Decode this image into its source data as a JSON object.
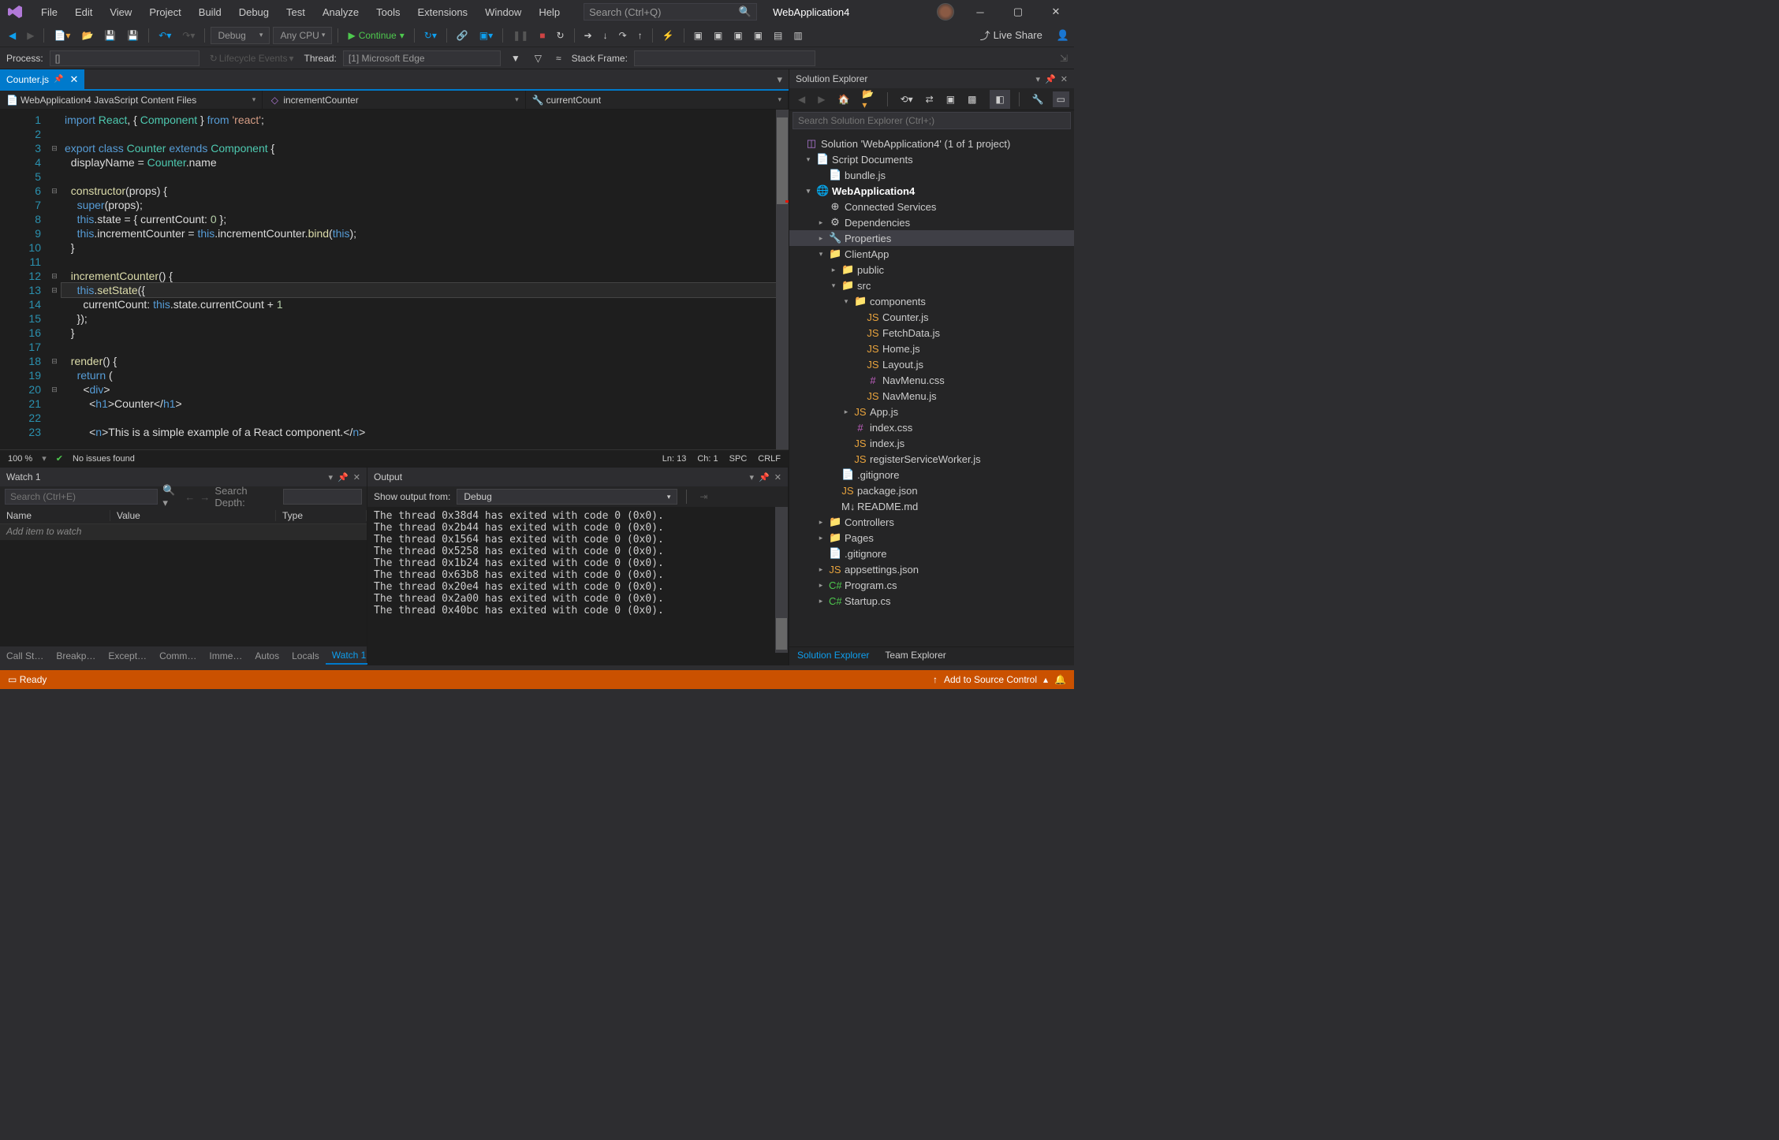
{
  "title": {
    "app": "WebApplication4",
    "search_placeholder": "Search (Ctrl+Q)"
  },
  "menu": [
    "File",
    "Edit",
    "View",
    "Project",
    "Build",
    "Debug",
    "Test",
    "Analyze",
    "Tools",
    "Extensions",
    "Window",
    "Help"
  ],
  "toolbar": {
    "config": "Debug",
    "platform": "Any CPU",
    "continue": "Continue",
    "live_share": "Live Share"
  },
  "toolbar2": {
    "process_label": "Process:",
    "process_value": "[]",
    "lifecycle": "Lifecycle Events",
    "thread_label": "Thread:",
    "thread_value": "[1] Microsoft Edge",
    "stack_label": "Stack Frame:"
  },
  "tab": {
    "name": "Counter.js"
  },
  "navbar": {
    "scope": "WebApplication4 JavaScript Content Files",
    "member": "incrementCounter",
    "detail": "currentCount"
  },
  "code": {
    "lines": [
      {
        "n": 1,
        "html": "<span class='kw'>import</span> <span class='cls'>React</span>, { <span class='cls'>Component</span> } <span class='kw'>from</span> <span class='str'>'react'</span>;"
      },
      {
        "n": 2,
        "html": ""
      },
      {
        "n": 3,
        "html": "<span class='kw'>export</span> <span class='kw'>class</span> <span class='cls'>Counter</span> <span class='kw'>extends</span> <span class='cls'>Component</span> {",
        "fold": "−"
      },
      {
        "n": 4,
        "html": "  displayName = <span class='cls'>Counter</span>.name"
      },
      {
        "n": 5,
        "html": ""
      },
      {
        "n": 6,
        "html": "  <span class='fn'>constructor</span>(props) {",
        "fold": "−"
      },
      {
        "n": 7,
        "html": "    <span class='kw'>super</span>(props);"
      },
      {
        "n": 8,
        "html": "    <span class='kw'>this</span>.state = { currentCount: <span class='num'>0</span> };"
      },
      {
        "n": 9,
        "html": "    <span class='kw'>this</span>.incrementCounter = <span class='kw'>this</span>.incrementCounter.<span class='fn'>bind</span>(<span class='kw'>this</span>);"
      },
      {
        "n": 10,
        "html": "  }"
      },
      {
        "n": 11,
        "html": ""
      },
      {
        "n": 12,
        "html": "  <span class='fn'>incrementCounter</span>() {",
        "fold": "−"
      },
      {
        "n": 13,
        "html": "    <span class='kw'>this</span>.<span class='fn'>setState</span>({",
        "current": true,
        "bp": true,
        "fold": "−"
      },
      {
        "n": 14,
        "html": "      currentCount: <span class='kw'>this</span>.state.currentCount + <span class='num'>1</span>"
      },
      {
        "n": 15,
        "html": "    });"
      },
      {
        "n": 16,
        "html": "  }"
      },
      {
        "n": 17,
        "html": ""
      },
      {
        "n": 18,
        "html": "  <span class='fn'>render</span>() {",
        "fold": "−"
      },
      {
        "n": 19,
        "html": "    <span class='kw'>return</span> ("
      },
      {
        "n": 20,
        "html": "      &lt;<span class='tag'>div</span>&gt;",
        "fold": "−"
      },
      {
        "n": 21,
        "html": "        &lt;<span class='tag'>h1</span>&gt;Counter&lt;/<span class='tag'>h1</span>&gt;"
      },
      {
        "n": 22,
        "html": ""
      },
      {
        "n": 23,
        "html": "        &lt;<span class='tag'>n</span>&gt;This is a simple example of a React component.&lt;/<span class='tag'>n</span>&gt;"
      }
    ]
  },
  "editor_status": {
    "zoom": "100 %",
    "issues": "No issues found",
    "ln": "Ln: 13",
    "ch": "Ch: 1",
    "spc": "SPC",
    "crlf": "CRLF"
  },
  "watch": {
    "title": "Watch 1",
    "search_placeholder": "Search (Ctrl+E)",
    "depth_label": "Search Depth:",
    "cols": {
      "name": "Name",
      "value": "Value",
      "type": "Type"
    },
    "add_prompt": "Add item to watch",
    "tabs": [
      "Call St…",
      "Breakp…",
      "Except…",
      "Comm…",
      "Imme…",
      "Autos",
      "Locals",
      "Watch 1"
    ]
  },
  "output": {
    "title": "Output",
    "from_label": "Show output from:",
    "from_value": "Debug",
    "lines": [
      "The thread 0x38d4 has exited with code 0 (0x0).",
      "The thread 0x2b44 has exited with code 0 (0x0).",
      "The thread 0x1564 has exited with code 0 (0x0).",
      "The thread 0x5258 has exited with code 0 (0x0).",
      "The thread 0x1b24 has exited with code 0 (0x0).",
      "The thread 0x63b8 has exited with code 0 (0x0).",
      "The thread 0x20e4 has exited with code 0 (0x0).",
      "The thread 0x2a00 has exited with code 0 (0x0).",
      "The thread 0x40bc has exited with code 0 (0x0)."
    ]
  },
  "solution": {
    "title": "Solution Explorer",
    "search_placeholder": "Search Solution Explorer (Ctrl+;)",
    "root": "Solution 'WebApplication4' (1 of 1 project)",
    "tree": [
      {
        "ind": 1,
        "arrow": "▾",
        "icon": "📄",
        "cls": "",
        "label": "Script Documents"
      },
      {
        "ind": 2,
        "arrow": "",
        "icon": "📄",
        "cls": "fjs",
        "label": "bundle.js"
      },
      {
        "ind": 1,
        "arrow": "▾",
        "icon": "🌐",
        "cls": "",
        "label": "WebApplication4",
        "bold": true
      },
      {
        "ind": 2,
        "arrow": "",
        "icon": "⊕",
        "cls": "",
        "label": "Connected Services"
      },
      {
        "ind": 2,
        "arrow": "▸",
        "icon": "⚙",
        "cls": "",
        "label": "Dependencies"
      },
      {
        "ind": 2,
        "arrow": "▸",
        "icon": "🔧",
        "cls": "",
        "label": "Properties",
        "sel": true
      },
      {
        "ind": 2,
        "arrow": "▾",
        "icon": "📁",
        "cls": "fld",
        "label": "ClientApp"
      },
      {
        "ind": 3,
        "arrow": "▸",
        "icon": "📁",
        "cls": "fld",
        "label": "public"
      },
      {
        "ind": 3,
        "arrow": "▾",
        "icon": "📁",
        "cls": "fld",
        "label": "src"
      },
      {
        "ind": 4,
        "arrow": "▾",
        "icon": "📁",
        "cls": "fld",
        "label": "components"
      },
      {
        "ind": 5,
        "arrow": "",
        "icon": "JS",
        "cls": "fjs",
        "label": "Counter.js"
      },
      {
        "ind": 5,
        "arrow": "",
        "icon": "JS",
        "cls": "fjs",
        "label": "FetchData.js"
      },
      {
        "ind": 5,
        "arrow": "",
        "icon": "JS",
        "cls": "fjs",
        "label": "Home.js"
      },
      {
        "ind": 5,
        "arrow": "",
        "icon": "JS",
        "cls": "fjs",
        "label": "Layout.js"
      },
      {
        "ind": 5,
        "arrow": "",
        "icon": "#",
        "cls": "fcss",
        "label": "NavMenu.css"
      },
      {
        "ind": 5,
        "arrow": "",
        "icon": "JS",
        "cls": "fjs",
        "label": "NavMenu.js"
      },
      {
        "ind": 4,
        "arrow": "▸",
        "icon": "JS",
        "cls": "fjs",
        "label": "App.js"
      },
      {
        "ind": 4,
        "arrow": "",
        "icon": "#",
        "cls": "fcss",
        "label": "index.css"
      },
      {
        "ind": 4,
        "arrow": "",
        "icon": "JS",
        "cls": "fjs",
        "label": "index.js"
      },
      {
        "ind": 4,
        "arrow": "",
        "icon": "JS",
        "cls": "fjs",
        "label": "registerServiceWorker.js"
      },
      {
        "ind": 3,
        "arrow": "",
        "icon": "📄",
        "cls": "",
        "label": ".gitignore"
      },
      {
        "ind": 3,
        "arrow": "",
        "icon": "JS",
        "cls": "fjs",
        "label": "package.json"
      },
      {
        "ind": 3,
        "arrow": "",
        "icon": "M↓",
        "cls": "",
        "label": "README.md"
      },
      {
        "ind": 2,
        "arrow": "▸",
        "icon": "📁",
        "cls": "fld",
        "label": "Controllers"
      },
      {
        "ind": 2,
        "arrow": "▸",
        "icon": "📁",
        "cls": "fld",
        "label": "Pages"
      },
      {
        "ind": 2,
        "arrow": "",
        "icon": "📄",
        "cls": "",
        "label": ".gitignore"
      },
      {
        "ind": 2,
        "arrow": "▸",
        "icon": "JS",
        "cls": "fjs",
        "label": "appsettings.json"
      },
      {
        "ind": 2,
        "arrow": "▸",
        "icon": "C#",
        "cls": "fcs",
        "label": "Program.cs"
      },
      {
        "ind": 2,
        "arrow": "▸",
        "icon": "C#",
        "cls": "fcs",
        "label": "Startup.cs"
      }
    ],
    "tabs": [
      "Solution Explorer",
      "Team Explorer"
    ]
  },
  "statusbar": {
    "ready": "Ready",
    "source_control": "Add to Source Control"
  }
}
